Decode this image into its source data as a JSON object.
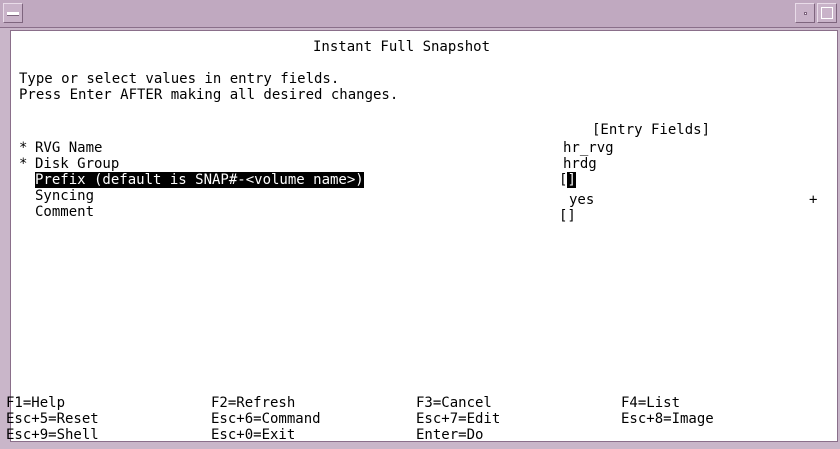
{
  "window": {
    "title": "Instant Full Snapshot",
    "colors": {
      "frame": "#c9b6c9",
      "terminal_bg": "#ffffff",
      "text": "#000000",
      "highlight": "#000000"
    }
  },
  "instructions": {
    "line1": "Type or select values in entry fields.",
    "line2": "Press Enter AFTER making all desired changes."
  },
  "entry_header": "[Entry Fields]",
  "fields": [
    {
      "required_mark": "*",
      "label": "RVG Name",
      "value": "hr_rvg",
      "indicator": ""
    },
    {
      "required_mark": "*",
      "label": "Disk Group",
      "value": "hrdg",
      "indicator": ""
    },
    {
      "required_mark": "",
      "label": "Prefix (default is SNAP#-<volume name>)",
      "value_open": "[",
      "value_close": "]",
      "indicator": ""
    },
    {
      "required_mark": "",
      "label": "Syncing",
      "value": "yes",
      "indicator": "+"
    },
    {
      "required_mark": "",
      "label": "Comment",
      "value": "[]",
      "indicator": ""
    }
  ],
  "function_keys": [
    [
      "F1=Help",
      "F2=Refresh",
      "F3=Cancel",
      "F4=List"
    ],
    [
      "Esc+5=Reset",
      "Esc+6=Command",
      "Esc+7=Edit",
      "Esc+8=Image"
    ],
    [
      "Esc+9=Shell",
      "Esc+0=Exit",
      "Enter=Do"
    ]
  ]
}
